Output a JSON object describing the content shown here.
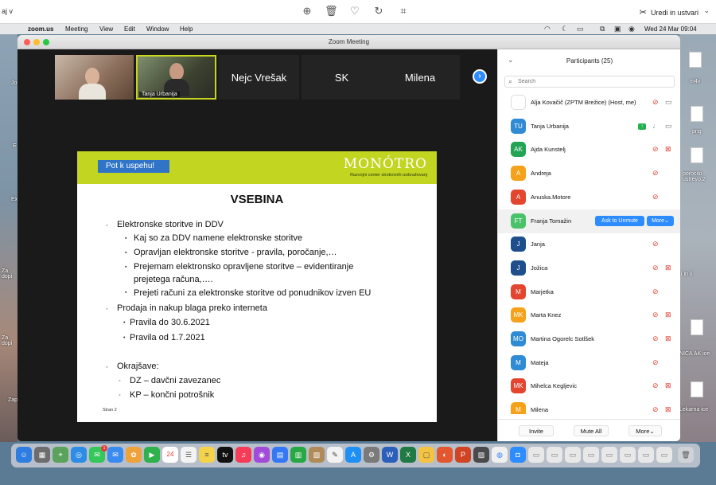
{
  "os_topbar": {
    "left_text": "aj v",
    "right_label": "Uredi in ustvari",
    "icons": [
      "zoom-in-icon",
      "trash-icon",
      "heart-icon",
      "rotate-icon",
      "crop-icon",
      "wand-icon",
      "chevron-down-icon"
    ]
  },
  "menubar": {
    "app": "zoom.us",
    "items": [
      "Meeting",
      "View",
      "Edit",
      "Window",
      "Help"
    ],
    "datetime": "Wed 24 Mar  09:04"
  },
  "desktop": {
    "left_labels": [
      "Jo",
      "E",
      "Ex",
      "Za dopi",
      "Za dopi",
      "Zap"
    ],
    "right_labels": [
      "m4v",
      "png",
      "porocilo ustrevo.2",
      "i in li",
      "NICA AK ice",
      "ice",
      "Lekarna ice"
    ]
  },
  "window": {
    "title": "Zoom Meeting"
  },
  "thumbnails": [
    {
      "name": "",
      "video": true
    },
    {
      "name": "Tanja Urbanija",
      "video": true,
      "active": true
    },
    {
      "name": "Nejc Vrešak",
      "video": false
    },
    {
      "name": "SK",
      "video": false
    },
    {
      "name": "Milena",
      "video": false
    }
  ],
  "slide": {
    "tagline": "Pot k uspehu!",
    "logo_name": "MONÓTRO",
    "logo_sub": "Razvojni center strokovnih izobraževanj",
    "title": "VSEBINA",
    "bullets": [
      "Elektronske storitve in DDV",
      "Kaj so za DDV namene elektronske storitve",
      "Opravljan elektronske storitve  - pravila, poročanje,…",
      "Prejemam elektronsko opravljene storitve – evidentiranje",
      "prejetega računa,….",
      "Prejeti računi za elektronske storitve od ponudnikov izven EU",
      "Prodaja in nakup blaga preko interneta",
      "Pravila do 30.6.2021",
      "Pravila od 1.7.2021",
      "Okrajšave:",
      "DZ – davčni zavezanec",
      "KP – končni potrošnik"
    ],
    "page": "Stran 2"
  },
  "participants": {
    "title": "Participants (25)",
    "search_placeholder": "Search",
    "list": [
      {
        "initials": "",
        "name": "Alja Kovačič (ZPTM Brežice) (Host, me)",
        "color": "#ffffff",
        "avatar_image": true,
        "mic": "muted",
        "cam": "on"
      },
      {
        "initials": "TU",
        "name": "Tanja Urbanija",
        "color": "#2e8bd4",
        "share": true,
        "mic": "on",
        "cam": "on"
      },
      {
        "initials": "AK",
        "name": "Ajda Kunstelj",
        "color": "#23a354",
        "mic": "muted",
        "cam": "off"
      },
      {
        "initials": "A",
        "name": "Andreja",
        "color": "#f5a21a",
        "mic": "muted"
      },
      {
        "initials": "A",
        "name": "Anuska.Motore",
        "color": "#e4452f",
        "mic": "muted"
      },
      {
        "initials": "FT",
        "name": "Franja Tomažin",
        "color": "#49c26a",
        "highlight": true,
        "buttons": [
          "Ask to Unmute",
          "More"
        ]
      },
      {
        "initials": "J",
        "name": "Janja",
        "color": "#1f4e8c",
        "mic": "muted"
      },
      {
        "initials": "J",
        "name": "Jožica",
        "color": "#1f4e8c",
        "mic": "muted",
        "cam": "off"
      },
      {
        "initials": "M",
        "name": "Marjetka",
        "color": "#e4452f",
        "mic": "muted"
      },
      {
        "initials": "MK",
        "name": "Marta Knez",
        "color": "#f5a21a",
        "mic": "muted",
        "cam": "off"
      },
      {
        "initials": "MO",
        "name": "Martina Ogorelc Sotlšek",
        "color": "#2e8bd4",
        "mic": "muted",
        "cam": "off"
      },
      {
        "initials": "M",
        "name": "Mateja",
        "color": "#2e8bd4",
        "mic": "muted"
      },
      {
        "initials": "MK",
        "name": "Mihelca Keglјevic",
        "color": "#e4452f",
        "mic": "muted",
        "cam": "off"
      },
      {
        "initials": "M",
        "name": "Milena",
        "color": "#f5a21a",
        "mic": "muted",
        "cam": "off"
      }
    ],
    "footer": {
      "invite": "Invite",
      "mute_all": "Mute All",
      "more": "More"
    }
  },
  "dock": {
    "badges": {
      "messages": "1"
    },
    "calendar_day": "24"
  }
}
